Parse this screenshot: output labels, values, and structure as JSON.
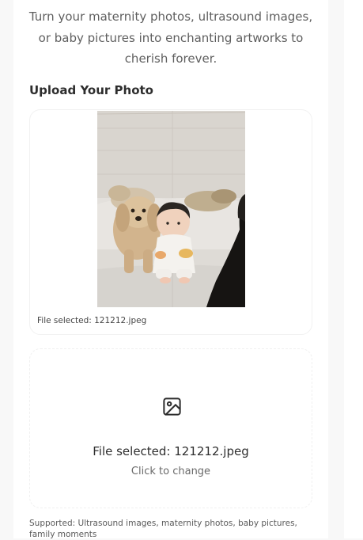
{
  "intro": {
    "text": "Turn your maternity photos, ultrasound images, or baby pictures into enchanting artworks to cherish forever."
  },
  "upload": {
    "section_title": "Upload Your Photo",
    "preview_caption": "File selected: 121212.jpeg",
    "dropzone_title": "File selected: 121212.jpeg",
    "dropzone_subtitle": "Click to change",
    "supported_text": "Supported: Ultrasound images, maternity photos, baby pictures, family moments",
    "icon": "image-icon"
  },
  "colors": {
    "background": "#f8f8f8",
    "card": "#ffffff",
    "text_primary": "#2e2e2e",
    "text_muted": "#5f5f5f",
    "border": "#f0f0f0"
  }
}
